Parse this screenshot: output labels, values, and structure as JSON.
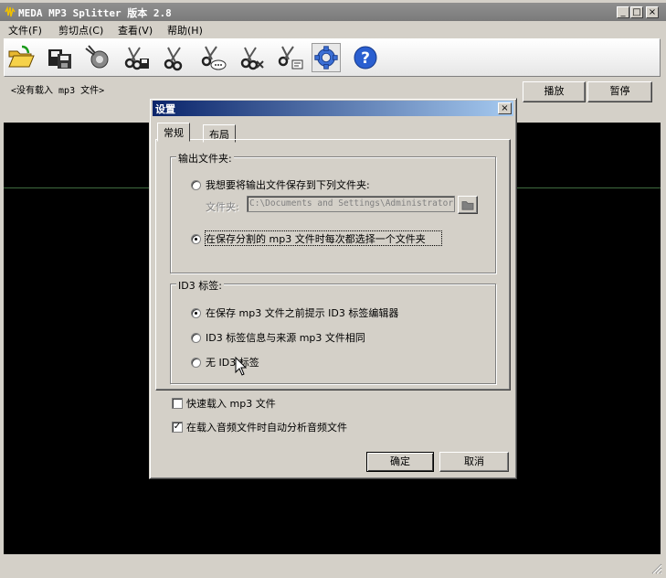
{
  "window": {
    "title": "MEDA MP3 Splitter 版本 2.8",
    "controls": {
      "minimize": "_",
      "maximize": "□",
      "close": "×"
    }
  },
  "menu": [
    "文件(F)",
    "剪切点(C)",
    "查看(V)",
    "帮助(H)"
  ],
  "toolbar": {
    "icons": [
      "open-folder-icon",
      "save-icon",
      "scan-icon",
      "cut-save-icon",
      "cut-icon",
      "cut-comment-icon",
      "cut-delete-icon",
      "cut-edit-icon",
      "settings-gear-icon",
      "help-icon"
    ]
  },
  "status": {
    "text": "<没有载入 mp3 文件>"
  },
  "playback": {
    "play": "播放",
    "pause": "暂停"
  },
  "dialog": {
    "title": "设置",
    "close": "×",
    "tabs": [
      "常规",
      "布局"
    ],
    "output_group": {
      "label": "输出文件夹:",
      "option_save_to": "我想要将输出文件保存到下列文件夹:",
      "folder_label": "文件夹:",
      "folder_value": "C:\\Documents and Settings\\Administrator",
      "option_choose_each": "在保存分割的 mp3 文件时每次都选择一个文件夹",
      "selected": "choose_each"
    },
    "id3_group": {
      "label": "ID3 标签:",
      "option_prompt": "在保存 mp3 文件之前提示 ID3 标签编辑器",
      "option_same": "ID3 标签信息与来源 mp3 文件相同",
      "option_none": "无 ID3 标签",
      "selected": "prompt"
    },
    "quick_load": {
      "label": "快速载入 mp3 文件",
      "checked": false
    },
    "auto_analyze": {
      "label": "在载入音频文件时自动分析音频文件",
      "checked": true,
      "mark": "✓"
    },
    "ok": "确定",
    "cancel": "取消"
  },
  "colors": {
    "titlebar_inactive": "#7a7a7a",
    "dialog_title_start": "#0a246a",
    "dialog_title_end": "#a6caf0",
    "wave_background": "#000000",
    "window_face": "#d4d0c8"
  }
}
